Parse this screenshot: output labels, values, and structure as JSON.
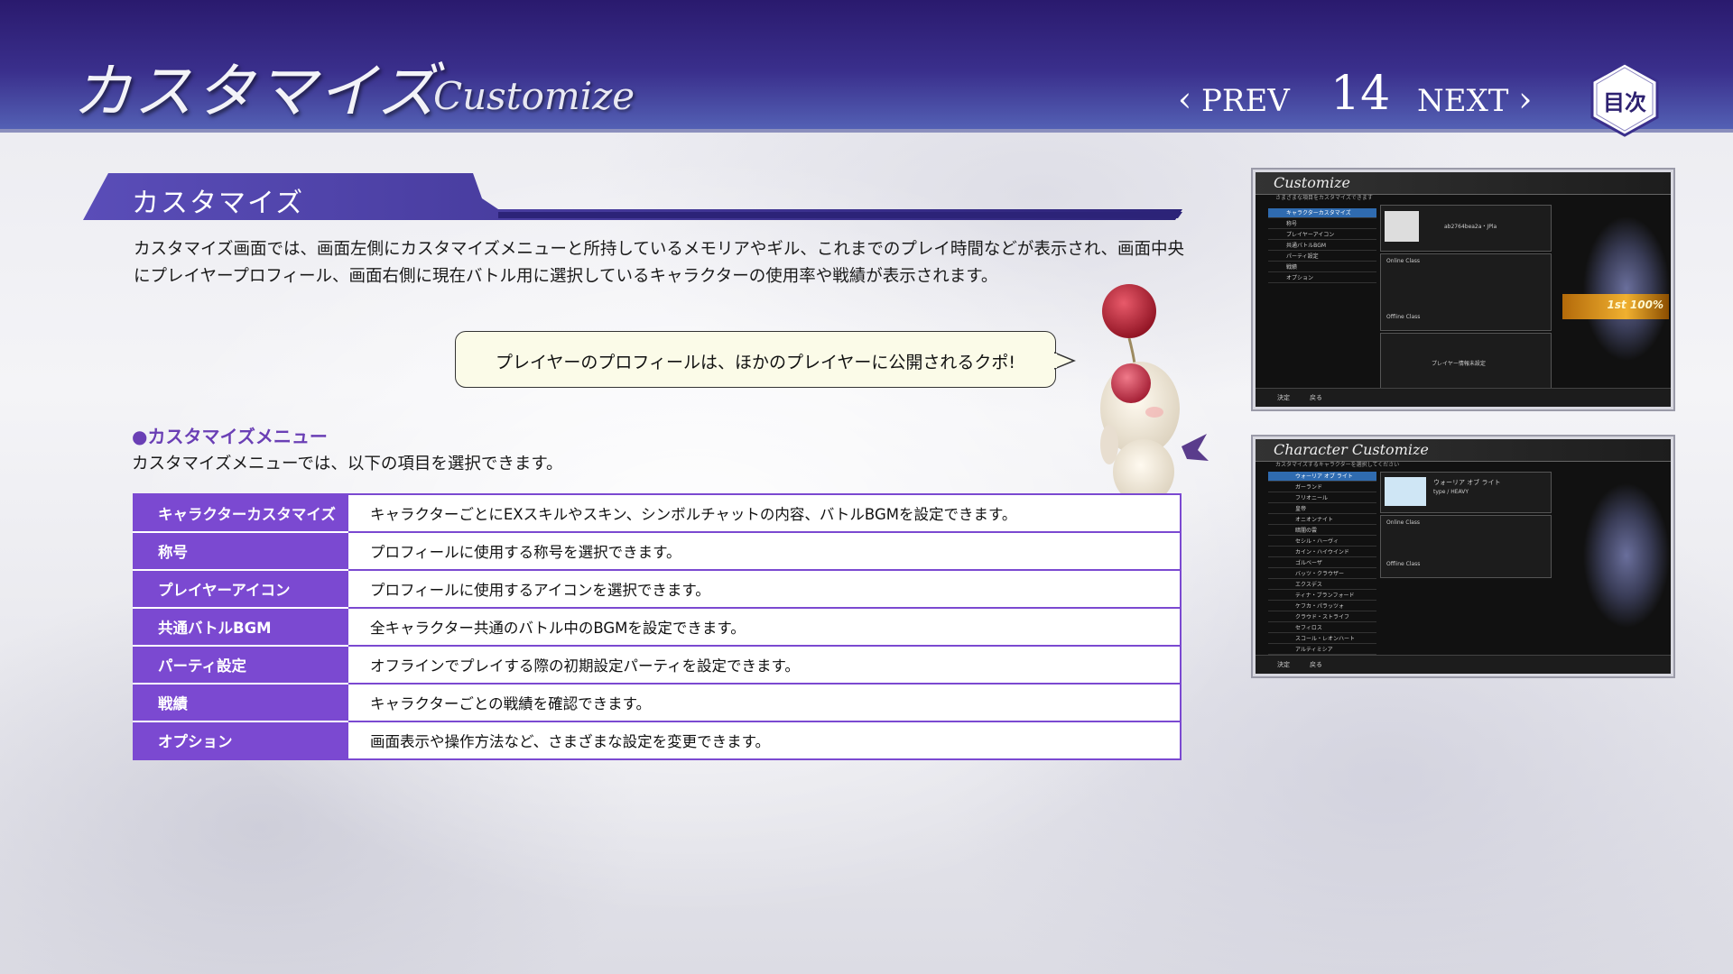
{
  "header": {
    "title_jp": "カスタマイズ",
    "title_en": "Customize",
    "prev_label": "PREV",
    "page_number": "14",
    "next_label": "NEXT",
    "toc_label": "目次"
  },
  "section": {
    "title": "カスタマイズ",
    "description": "カスタマイズ画面では、画面左側にカスタマイズメニューと所持しているメモリアやギル、これまでのプレイ時間などが表示され、画面中央にプレイヤープロフィール、画面右側に現在バトル用に選択しているキャラクターの使用率や戦績が表示されます。"
  },
  "bubble": {
    "text": "プレイヤーのプロフィールは、ほかのプレイヤーに公開されるクポ!"
  },
  "menu": {
    "heading": "●カスタマイズメニュー",
    "subtext": "カスタマイズメニューでは、以下の項目を選択できます。",
    "rows": [
      {
        "key": "キャラクターカスタマイズ",
        "value": "キャラクターごとにEXスキルやスキン、シンボルチャットの内容、バトルBGMを設定できます。"
      },
      {
        "key": "称号",
        "value": "プロフィールに使用する称号を選択できます。"
      },
      {
        "key": "プレイヤーアイコン",
        "value": "プロフィールに使用するアイコンを選択できます。"
      },
      {
        "key": "共通バトルBGM",
        "value": "全キャラクター共通のバトル中のBGMを設定できます。"
      },
      {
        "key": "パーティ設定",
        "value": "オフラインでプレイする際の初期設定パーティを設定できます。"
      },
      {
        "key": "戦績",
        "value": "キャラクターごとの戦績を確認できます。"
      },
      {
        "key": "オプション",
        "value": "画面表示や操作方法など、さまざまな設定を変更できます。"
      }
    ]
  },
  "screenshot1": {
    "title": "Customize",
    "subtitle": "さまざまな項目をカスタマイズできます",
    "menu_items": [
      "キャラクターカスタマイズ",
      "称号",
      "プレイヤーアイコン",
      "共通バトルBGM",
      "パーティ設定",
      "戦績",
      "オプション"
    ],
    "player_id": "ab2764bea2a・JPla",
    "online_class": "Online Class",
    "offline_class": "Offline Class",
    "rank_text": "1st 100%",
    "player_info": "プレイヤー情報未設定",
    "footer_confirm": "決定",
    "footer_back": "戻る"
  },
  "screenshot2": {
    "title": "Character Customize",
    "subtitle": "カスタマイズするキャラクターを選択してください",
    "characters": [
      "ウォーリア オブ ライト",
      "ガーランド",
      "フリオニール",
      "皇帝",
      "オニオンナイト",
      "暗闇の雲",
      "セシル・ハーヴィ",
      "カイン・ハイウインド",
      "ゴルベーザ",
      "バッツ・クラウザー",
      "エクスデス",
      "ティナ・ブランフォード",
      "ケフカ・パラッツォ",
      "クラウド・ストライフ",
      "セフィロス",
      "スコール・レオンハート",
      "アルティミシア"
    ],
    "char_name": "ウォーリア オブ ライト",
    "char_type": "type / HEAVY",
    "online_class": "Online Class",
    "offline_class": "Offline Class",
    "footer_confirm": "決定",
    "footer_back": "戻る"
  }
}
